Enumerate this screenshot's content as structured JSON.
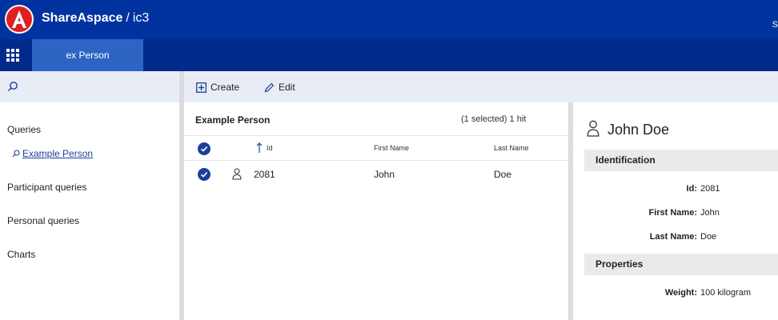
{
  "header": {
    "brand": "ShareAspace",
    "separator": "/",
    "project": "ic3",
    "right_text": "S"
  },
  "tabs": [
    {
      "label": "ex Person"
    }
  ],
  "sidebar": {
    "sections": [
      {
        "label": "Queries"
      },
      {
        "label": "Participant queries"
      },
      {
        "label": "Personal queries"
      },
      {
        "label": "Charts"
      }
    ],
    "query_link": "Example Person"
  },
  "toolbar": {
    "create_label": "Create",
    "edit_label": "Edit"
  },
  "list": {
    "title": "Example Person",
    "count": "(1 selected) 1 hit",
    "columns": [
      "Id",
      "First Name",
      "Last Name"
    ],
    "rows": [
      {
        "id": "2081",
        "first_name": "John",
        "last_name": "Doe"
      }
    ]
  },
  "detail": {
    "name": "John Doe",
    "sections": [
      {
        "title": "Identification",
        "props": [
          {
            "key": "Id:",
            "value": "2081"
          },
          {
            "key": "First Name:",
            "value": "John"
          },
          {
            "key": "Last Name:",
            "value": "Doe"
          }
        ]
      },
      {
        "title": "Properties",
        "props": [
          {
            "key": "Weight:",
            "value": "100 kilogram"
          }
        ]
      }
    ]
  },
  "colors": {
    "header_bg": "#0033a0",
    "tabbar_bg": "#002b8c",
    "active_tab": "#2e64c4",
    "accent": "#1b3f9a",
    "logo_red": "#e02020"
  }
}
